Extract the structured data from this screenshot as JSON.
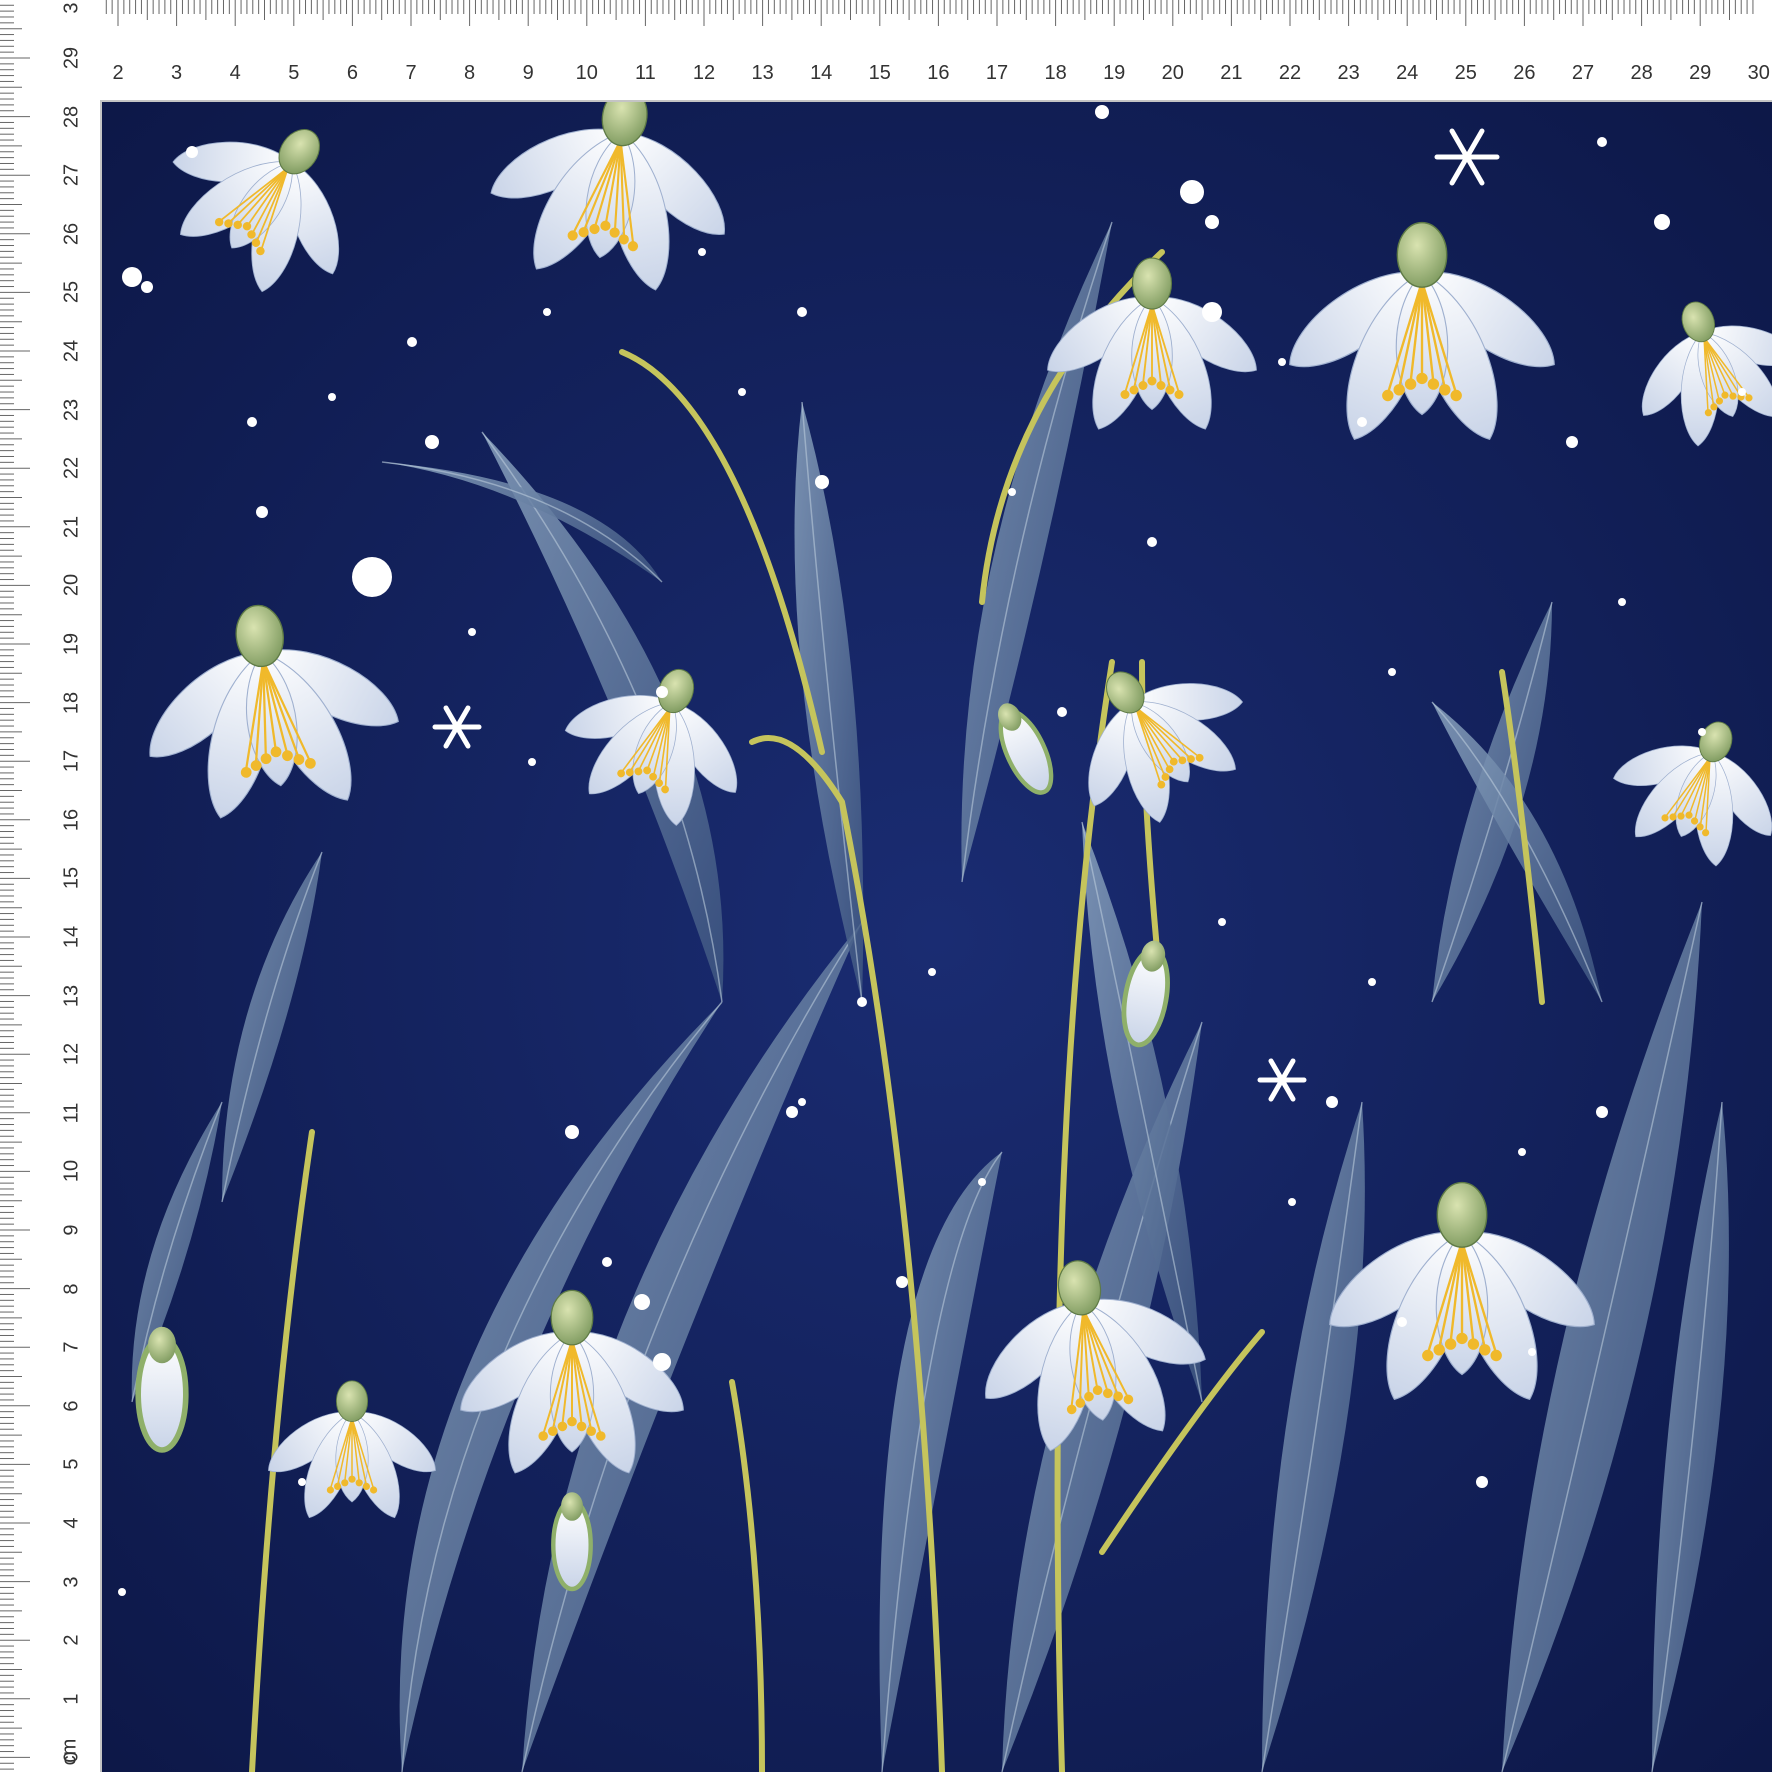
{
  "ruler": {
    "unit_label": "cm",
    "horizontal_labels": [
      "2",
      "3",
      "4",
      "5",
      "6",
      "7",
      "8",
      "9",
      "10",
      "11",
      "12",
      "13",
      "14",
      "15",
      "16",
      "17",
      "18",
      "19",
      "20",
      "21",
      "22",
      "23",
      "24",
      "25",
      "26",
      "27",
      "28",
      "29",
      "30"
    ],
    "vertical_labels": [
      "29",
      "28",
      "27",
      "26",
      "25",
      "24",
      "23",
      "22",
      "21",
      "20",
      "19",
      "18",
      "17",
      "16",
      "15",
      "14",
      "13",
      "12",
      "11",
      "10",
      "9",
      "8",
      "7",
      "6",
      "5",
      "4",
      "3",
      "2",
      "1",
      "0"
    ],
    "corner_label": "3"
  },
  "colors": {
    "background_navy": "#12205a",
    "petal_white": "#f4f7fb",
    "petal_shade": "#bcc9e0",
    "stamen_yellow": "#f0b92b",
    "bud_green": "#9bb37c",
    "leaf_blue": "#6f88a8",
    "stem_yellow_green": "#c5c45c",
    "snow_dot": "#ffffff"
  },
  "pattern": {
    "subject": "snowdrop-flowers",
    "icons": [
      "snowdrop-flower-icon",
      "leaf-icon",
      "bud-icon",
      "snowflake-icon",
      "snow-dot-icon"
    ]
  }
}
